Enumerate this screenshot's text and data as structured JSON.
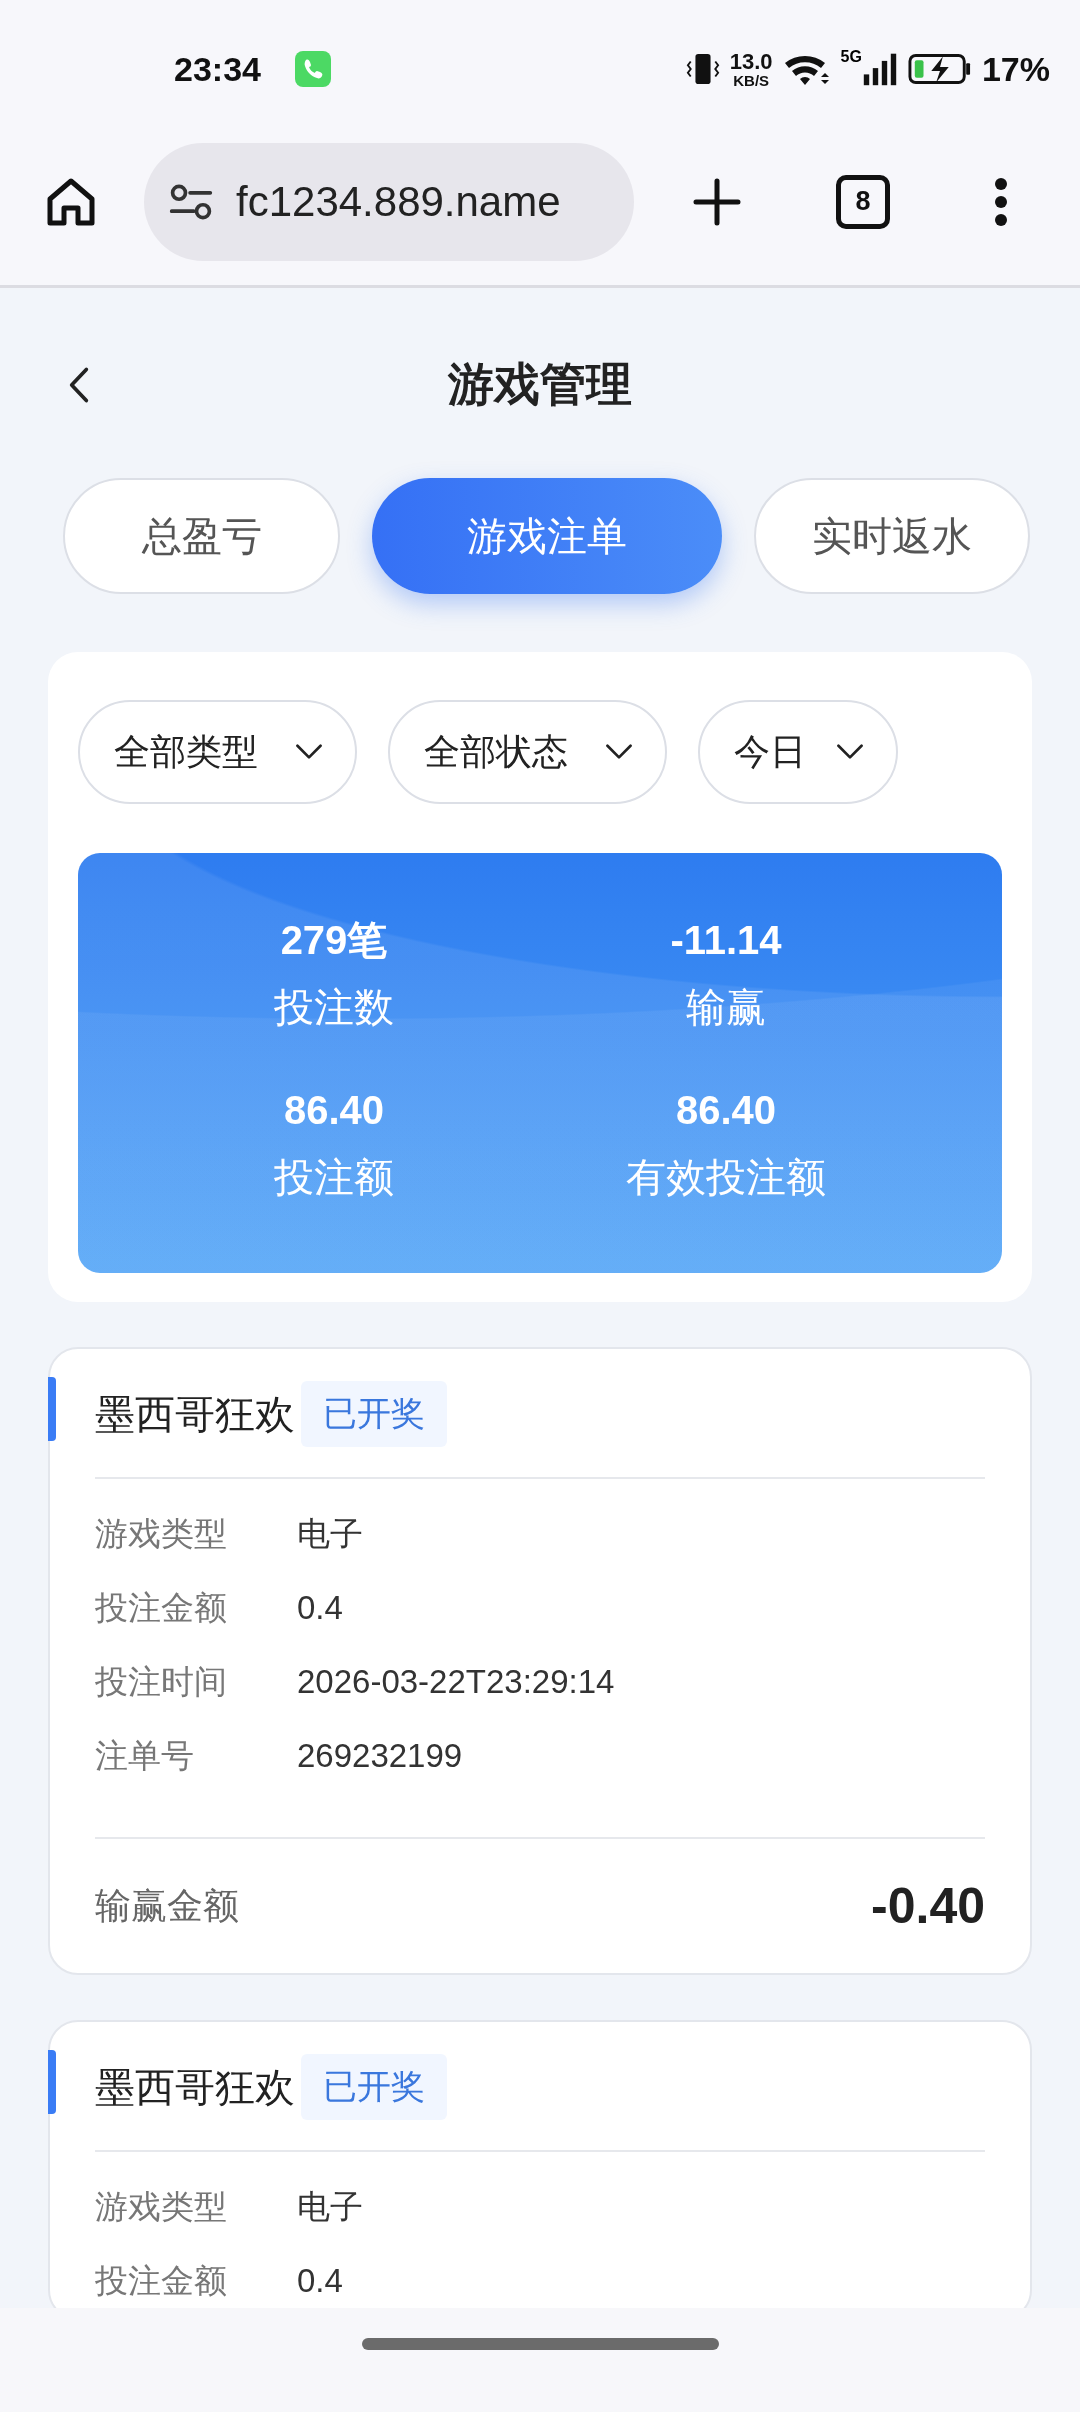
{
  "status_bar": {
    "time": "23:34",
    "speed_value": "13.0",
    "speed_unit": "KB/S",
    "network": "5G",
    "battery": "17%"
  },
  "browser": {
    "url": "fc1234.889.name",
    "tab_count": "8"
  },
  "page": {
    "title": "游戏管理"
  },
  "tabs": [
    {
      "label": "总盈亏",
      "selected": false
    },
    {
      "label": "游戏注单",
      "selected": true
    },
    {
      "label": "实时返水",
      "selected": false
    }
  ],
  "filters": [
    {
      "label": "全部类型"
    },
    {
      "label": "全部状态"
    },
    {
      "label": "今日"
    }
  ],
  "summary": [
    {
      "value": "279笔",
      "label": "投注数"
    },
    {
      "value": "-11.14",
      "label": "输赢"
    },
    {
      "value": "86.40",
      "label": "投注额"
    },
    {
      "value": "86.40",
      "label": "有效投注额"
    }
  ],
  "bets": [
    {
      "game": "墨西哥狂欢",
      "status": "已开奖",
      "fields": [
        {
          "label": "游戏类型",
          "value": "电子"
        },
        {
          "label": "投注金额",
          "value": "0.4"
        },
        {
          "label": "投注时间",
          "value": "2026-03-22T23:29:14"
        },
        {
          "label": "注单号",
          "value": "269232199"
        }
      ],
      "result": {
        "label": "输赢金额",
        "value": "-0.40"
      }
    },
    {
      "game": "墨西哥狂欢",
      "status": "已开奖",
      "fields": [
        {
          "label": "游戏类型",
          "value": "电子"
        },
        {
          "label": "投注金额",
          "value": "0.4"
        }
      ]
    }
  ]
}
